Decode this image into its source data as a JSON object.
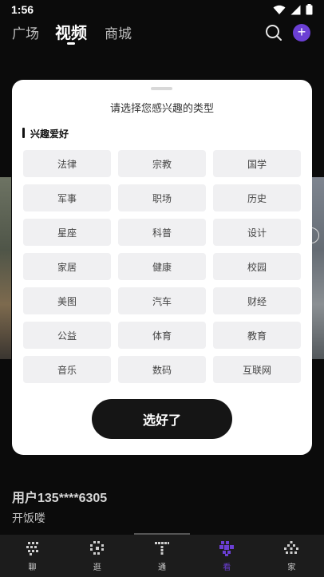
{
  "status_bar": {
    "time": "1:56"
  },
  "top_nav": {
    "tabs": [
      {
        "label": "广场"
      },
      {
        "label": "视频",
        "active": true
      },
      {
        "label": "商城"
      }
    ],
    "plus_label": "+"
  },
  "dialog": {
    "title": "请选择您感兴趣的类型",
    "section_label": "兴趣爱好",
    "interests": [
      "法律",
      "宗教",
      "国学",
      "军事",
      "职场",
      "历史",
      "星座",
      "科普",
      "设计",
      "家居",
      "健康",
      "校园",
      "美图",
      "汽车",
      "财经",
      "公益",
      "体育",
      "教育",
      "音乐",
      "数码",
      "互联网"
    ],
    "confirm_label": "选好了"
  },
  "video": {
    "username": "用户135****6305",
    "caption": "开饭喽"
  },
  "bottom_nav": {
    "items": [
      {
        "label": "聊",
        "icon": "chat-icon"
      },
      {
        "label": "逛",
        "icon": "browse-icon"
      },
      {
        "label": "通",
        "icon": "contacts-icon"
      },
      {
        "label": "看",
        "icon": "watch-icon",
        "active": true
      },
      {
        "label": "家",
        "icon": "home-icon"
      }
    ]
  },
  "colors": {
    "accent": "#6b3fd4",
    "dialog_bg": "#ffffff",
    "chip_bg": "#f0f0f2",
    "button_bg": "#151515"
  }
}
